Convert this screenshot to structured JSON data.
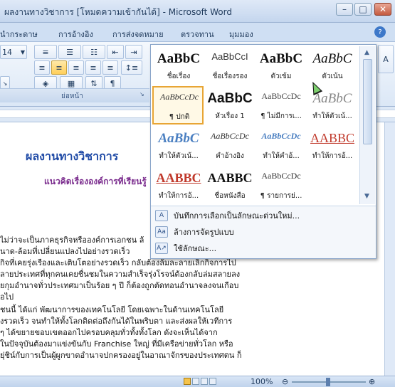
{
  "window": {
    "title": "ผลงานทางวิชาการ [โหมดความเข้ากันได้] - Microsoft Word"
  },
  "ribbon_tabs": [
    "นำกระดาษ",
    "การอ้างอิง",
    "การส่งจดหมาย",
    "ตรวจทาน",
    "มุมมอง"
  ],
  "ribbon": {
    "font_size": "14",
    "paragraph_group_label": "ย่อหน้า"
  },
  "style_gallery": {
    "styles": [
      {
        "preview": "AaBbC",
        "name": "ชื่อเรื่อง"
      },
      {
        "preview": "AaBbCcI",
        "name": "ชื่อเรื่องรอง"
      },
      {
        "preview": "AaBbC",
        "name": "ตัวเข้ม"
      },
      {
        "preview": "AaBbC",
        "name": "ตัวเน้น"
      },
      {
        "preview": "AaBbCcDc",
        "name": "¶ ปกติ"
      },
      {
        "preview": "AaBbC",
        "name": "หัวเรื่อง 1"
      },
      {
        "preview": "AaBbCcDc",
        "name": "¶ ไม่มีการเ..."
      },
      {
        "preview": "AaBbC",
        "name": "ทำให้ตัวเน้..."
      },
      {
        "preview": "AaBbC",
        "name": "ทำให้ตัวเน้..."
      },
      {
        "preview": "AaBbCcDc",
        "name": "คำอ้างอิง"
      },
      {
        "preview": "AaBbCcDc",
        "name": "ทำให้คำอ้..."
      },
      {
        "preview": "AABBC",
        "name": "ทำให้การอ้..."
      },
      {
        "preview": "AABBC",
        "name": "ทำให้การอ้..."
      },
      {
        "preview": "AABBC",
        "name": "ชื่อหนังสือ"
      },
      {
        "preview": "AaBbCcDc",
        "name": "¶ รายการย่..."
      }
    ],
    "menu": [
      {
        "icon": "save-selection-icon",
        "label": "บันทึกการเลือกเป็นลักษณะด่วนใหม่..."
      },
      {
        "icon": "clear-format-icon",
        "label": "ล้างการจัดรูปแบบ"
      },
      {
        "icon": "apply-style-icon",
        "label": "ใช้ลักษณะ..."
      }
    ]
  },
  "document": {
    "title": "ผลงานทางวิชาการ",
    "subtitle": "แนวคิดเรื่ององค์การที่เรียนรู้",
    "paragraph_lines": [
      "ไม่ว่าจะเป็นภาคธุรกิจหรือองค์การเอกชน ล้",
      "นาด-ล้อมที่เปลี่ยนแปลงไปอย่างรวดเร็ว",
      "กิจที่เคยรุ่งเรืองและเติบโตอย่างรวดเร็ว กลับต้องล้มละลายเลิกกิจการไป",
      "ลายประเทศที่ทุกคนเคยชื่นชมในความสำเร็จรุ่งโรจน์ต้องกลับล่มสลายลง",
      "ยกุมอำนาจทั่วประเทศมาเป็นร้อย ๆ ปี ก็ต้องถูกตัดทอนอำนาจลงจนเกือบ",
      "อไป",
      "ชนนี้ ได้แก่ พัฒนาการของเทคโนโลยี โดยเฉพาะในด้านเทคโนโลยี",
      "งรวดเร็ว จนทำให้ทั้งโลกติดต่อถึงกันได้ในพริบตา และส่งผลให้เวทีการ",
      "ๆ ได้ขยายขอบเขตออกไปครอบคลุมทั่วทั้งทั้งโลก ดังจะเห็นได้จาก",
      "ในปัจจุบันต้องมาแข่งขันกับ Franchise ใหญ่ ที่มีเครือข่ายทั่วโลก หรือ",
      "ยุ่ชิน์กับการเป็นผู้ผูกขาดอำนาจปกครองอยู่ในอาณาจักรของประเทศตน ก็"
    ]
  },
  "status": {
    "zoom": "100%"
  }
}
